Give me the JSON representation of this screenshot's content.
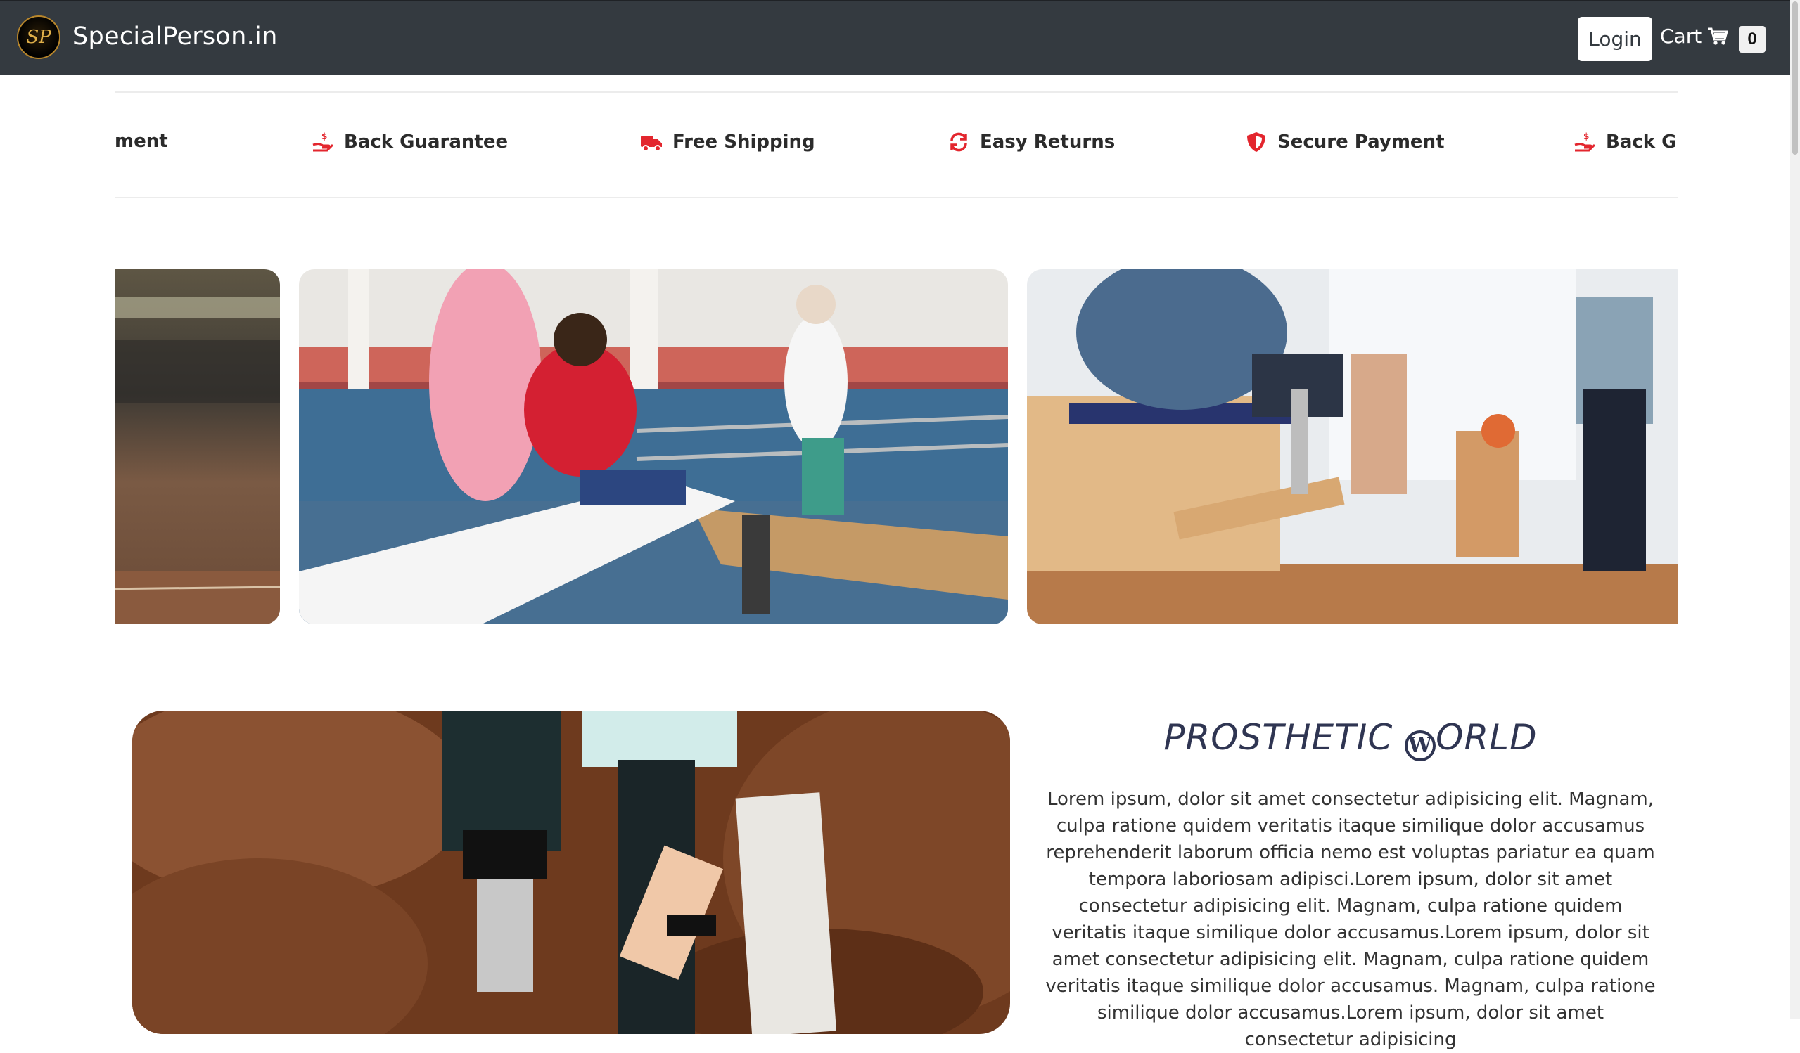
{
  "navbar": {
    "logo_text": "SP",
    "brand": "SpecialPerson.in",
    "login_label": "Login",
    "cart_label": "Cart",
    "cart_count": "0",
    "bg_color": "#343a40"
  },
  "features": {
    "accent_color": "#e3262e",
    "items": [
      {
        "label": "ment",
        "icon": "shield-icon"
      },
      {
        "label": "Back Guarantee",
        "icon": "hand-money-icon"
      },
      {
        "label": "Free Shipping",
        "icon": "truck-icon"
      },
      {
        "label": "Easy Returns",
        "icon": "refresh-icon"
      },
      {
        "label": "Secure Payment",
        "icon": "shield-icon"
      },
      {
        "label": "Back Gu",
        "icon": "hand-money-icon"
      }
    ]
  },
  "about": {
    "title_part1": "PROSTHETIC ",
    "title_glyph": "W",
    "title_part2": "ORLD",
    "text": "Lorem ipsum, dolor sit amet consectetur adipisicing elit. Magnam, culpa ratione quidem veritatis itaque similique dolor accusamus reprehenderit laborum officia nemo est voluptas pariatur ea quam tempora laboriosam adipisci.Lorem ipsum, dolor sit amet consectetur adipisicing elit. Magnam, culpa ratione quidem veritatis itaque similique dolor accusamus.Lorem ipsum, dolor sit amet consectetur adipisicing elit. Magnam, culpa ratione quidem veritatis itaque similique dolor accusamus. Magnam, culpa ratione similique dolor accusamus.Lorem ipsum, dolor sit amet consectetur adipisicing"
  }
}
